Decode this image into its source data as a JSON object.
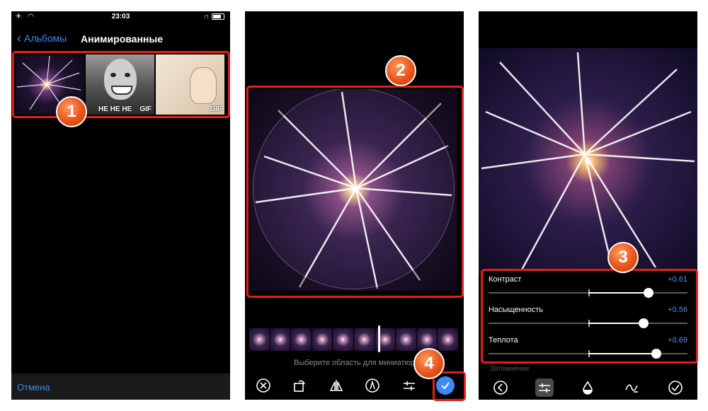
{
  "panel1": {
    "status": {
      "time": "23:03"
    },
    "nav": {
      "back_label": "Альбомы",
      "title": "Анимированные"
    },
    "thumbnails": [
      {
        "name": "sparkle",
        "caption": "",
        "badge": ""
      },
      {
        "name": "voldemort",
        "caption": "HE HE HE",
        "badge": "GIF"
      },
      {
        "name": "anime",
        "caption": "",
        "badge": "GIF"
      }
    ],
    "cancel_label": "Отмена"
  },
  "panel2": {
    "hint": "Выберите область для миниатюр",
    "toolbar": [
      "close-icon",
      "rotate-icon",
      "mirror-icon",
      "markup-icon",
      "adjust-icon",
      "done-icon"
    ]
  },
  "panel3": {
    "adjustments": [
      {
        "label": "Контраст",
        "value": "+0.61",
        "level": 0.61
      },
      {
        "label": "Насыщенность",
        "value": "+0.56",
        "level": 0.56
      },
      {
        "label": "Теплота",
        "value": "+0.69",
        "level": 0.69
      }
    ],
    "next_label": "Затемнение",
    "toolbar": [
      "back-icon",
      "sliders-icon",
      "tint-icon",
      "curves-icon",
      "done-icon"
    ]
  },
  "markers": [
    "1",
    "2",
    "3",
    "4"
  ],
  "colors": {
    "accent": "#3b8af6",
    "highlight": "#e41e1e",
    "marker": "#e8541a",
    "value": "#5b8dfa"
  }
}
